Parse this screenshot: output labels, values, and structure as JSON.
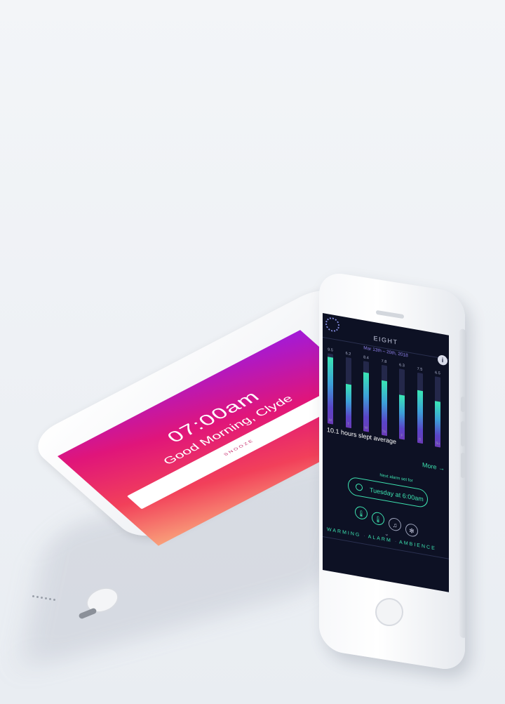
{
  "lock_screen": {
    "time": "07:00am",
    "greeting": "Good Morning, Clyde",
    "snooze_label": "SNOOZE"
  },
  "app": {
    "title": "EIGHT",
    "date_range": "Mar 13th – 20th, 2018",
    "sleep_bars": [
      {
        "day": "M",
        "value": "9.5",
        "fraction": 0.95
      },
      {
        "day": "T",
        "value": "6.2",
        "fraction": 0.62
      },
      {
        "day": "W",
        "value": "8.4",
        "fraction": 0.84
      },
      {
        "day": "Th",
        "value": "7.8",
        "fraction": 0.78
      },
      {
        "day": "F",
        "value": "6.3",
        "fraction": 0.63
      },
      {
        "day": "S",
        "value": "7.5",
        "fraction": 0.75
      },
      {
        "day": "Su",
        "value": "6.5",
        "fraction": 0.65
      }
    ],
    "average_text": "10.1 hours slept average",
    "more_label": "More →",
    "next_alarm_label": "Next alarm set for",
    "next_alarm_value": "Tuesday  at 6:00am",
    "modes": [
      "thermometer-icon",
      "thermometer-icon",
      "music-icon",
      "fan-icon"
    ],
    "tabs": [
      "WARMING",
      "ALARM",
      "AMBIENCE"
    ],
    "accent_color": "#3de3b0",
    "background_color": "#0d1124"
  }
}
